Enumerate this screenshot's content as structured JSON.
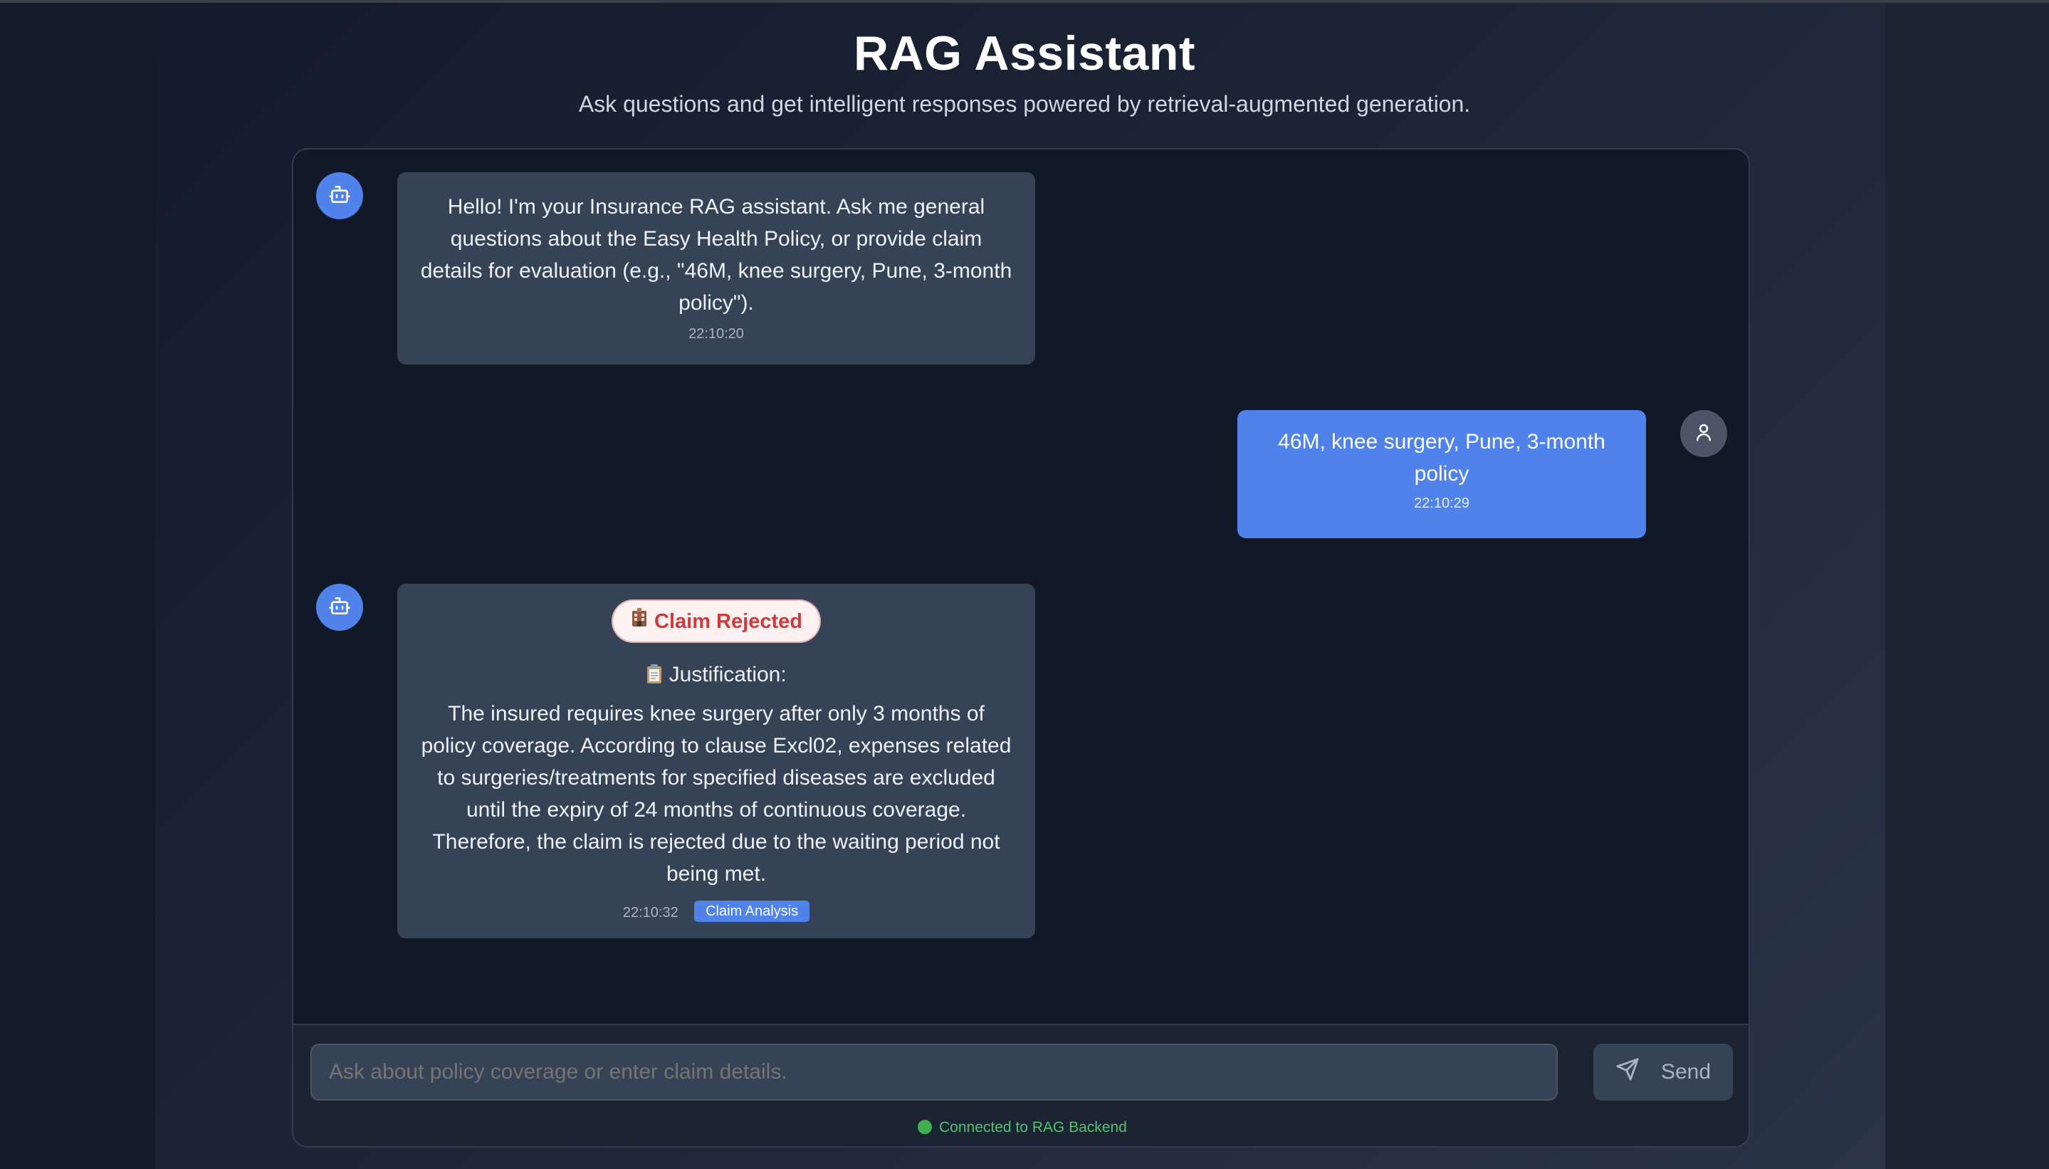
{
  "header": {
    "title": "RAG Assistant",
    "subtitle": "Ask questions and get intelligent responses powered by retrieval-augmented generation."
  },
  "messages": [
    {
      "role": "bot",
      "avatar_icon": "bot-icon",
      "text": "Hello! I'm your Insurance RAG assistant. Ask me general questions about the Easy Health Policy, or provide claim details for evaluation (e.g., \"46M, knee surgery, Pune, 3-month policy\").",
      "time": "22:10:20"
    },
    {
      "role": "user",
      "avatar_icon": "user-icon",
      "text": "46M, knee surgery, Pune, 3-month policy",
      "time": "22:10:29"
    },
    {
      "role": "bot",
      "avatar_icon": "bot-icon",
      "decision_icon": "hospital-icon",
      "decision": "Claim Rejected",
      "justification_icon": "clipboard-icon",
      "justification_title": "Justification:",
      "text": "The insured requires knee surgery after only 3 months of policy coverage. According to clause Excl02, expenses related to surgeries/treatments for specified diseases are excluded until the expiry of 24 months of continuous coverage. Therefore, the claim is rejected due to the waiting period not being met.",
      "time": "22:10:32",
      "tag": "Claim Analysis"
    }
  ],
  "input": {
    "placeholder": "Ask about policy coverage or enter claim details.",
    "value": ""
  },
  "send_button": {
    "label": "Send",
    "icon": "send-icon"
  },
  "status": {
    "text": "Connected to RAG Backend",
    "color": "#3fae4f"
  },
  "colors": {
    "accent": "#4f82ea",
    "bot_bubble": "#364255",
    "rejected": "#d03a3a"
  }
}
